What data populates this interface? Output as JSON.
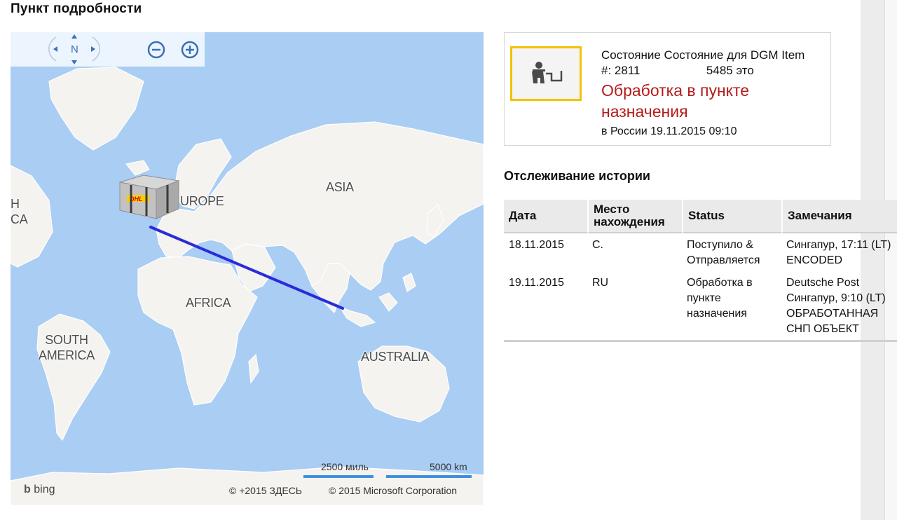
{
  "page_title": "Пункт подробности",
  "map": {
    "compass_label": "N",
    "labels": {
      "europe": "UROPE",
      "asia": "ASIA",
      "africa": "AFRICA",
      "south_america_line1": "SOUTH",
      "south_america_line2": "AMERICA",
      "australia": "AUSTRALIA",
      "north_america_fragment_1": "H",
      "north_america_fragment_2": "CA"
    },
    "scale_miles": "2500 миль",
    "scale_km": "5000 km",
    "copyright_here": "© +2015 ЗДЕСЬ",
    "copyright_ms": "© 2015 Microsoft Corporation",
    "bing": "bing",
    "route_color": "#2b2bd8"
  },
  "status": {
    "line1": "Состояние Состояние для DGM Item",
    "line2": "#: 2811                    5485 это",
    "headline": "Обработка в пункте назначения",
    "subline": "в России 19.11.2015 09:10",
    "headline_color": "#b41c1c",
    "icon": "courier-desk-icon"
  },
  "history": {
    "title": "Отслеживание истории",
    "columns": [
      "Дата",
      "Место нахождения",
      "Status",
      "Замечания"
    ],
    "rows": [
      [
        "18.11.2015",
        "C.",
        "Поступило & Отправляется",
        "Сингапур, 17:11 (LT) ENCODED"
      ],
      [
        "19.11.2015",
        "RU",
        "Обработка в пункте назначения",
        "Deutsche Post Сингапур, 9:10 (LT) ОБРАБОТАННАЯ СНП ОБЪЕКТ"
      ]
    ]
  }
}
